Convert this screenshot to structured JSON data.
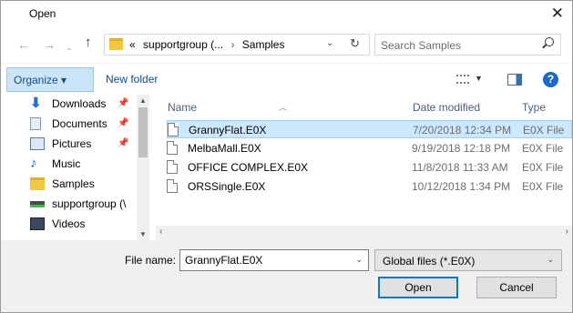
{
  "window": {
    "title": "Open"
  },
  "address": {
    "crumb_prefix": "«",
    "crumb_1": "supportgroup (...",
    "crumb_sep": "›",
    "crumb_2": "Samples"
  },
  "search": {
    "placeholder": "Search Samples"
  },
  "toolbar": {
    "organize_label": "Organize ▾",
    "new_folder_label": "New folder",
    "help_label": "?"
  },
  "nav": {
    "items": [
      {
        "label": "Downloads",
        "icon": "download-icon",
        "pinned": true
      },
      {
        "label": "Documents",
        "icon": "documents-icon",
        "pinned": true
      },
      {
        "label": "Pictures",
        "icon": "pictures-icon",
        "pinned": true
      },
      {
        "label": "Music",
        "icon": "music-icon",
        "pinned": false
      },
      {
        "label": "Samples",
        "icon": "folder-icon",
        "pinned": false
      },
      {
        "label": "supportgroup (\\",
        "icon": "network-drive-icon",
        "pinned": false
      },
      {
        "label": "Videos",
        "icon": "videos-icon",
        "pinned": false
      }
    ]
  },
  "files": {
    "columns": {
      "name": "Name",
      "date": "Date modified",
      "type": "Type"
    },
    "rows": [
      {
        "name": "GrannyFlat.E0X",
        "date": "7/20/2018 12:34 PM",
        "type": "E0X File",
        "selected": true
      },
      {
        "name": "MelbaMall.E0X",
        "date": "9/19/2018 12:18 PM",
        "type": "E0X File",
        "selected": false
      },
      {
        "name": "OFFICE COMPLEX.E0X",
        "date": "11/8/2018 11:33 AM",
        "type": "E0X File",
        "selected": false
      },
      {
        "name": "ORSSingle.E0X",
        "date": "10/12/2018 1:34 PM",
        "type": "E0X File",
        "selected": false
      }
    ]
  },
  "bottom": {
    "filename_label": "File name:",
    "filename_value": "GrannyFlat.E0X",
    "filter_value": "Global files (*.E0X)",
    "open_label": "Open",
    "cancel_label": "Cancel"
  },
  "colors": {
    "accent": "#0078d7",
    "selection": "#cce8ff",
    "link": "#0e4c8a"
  }
}
